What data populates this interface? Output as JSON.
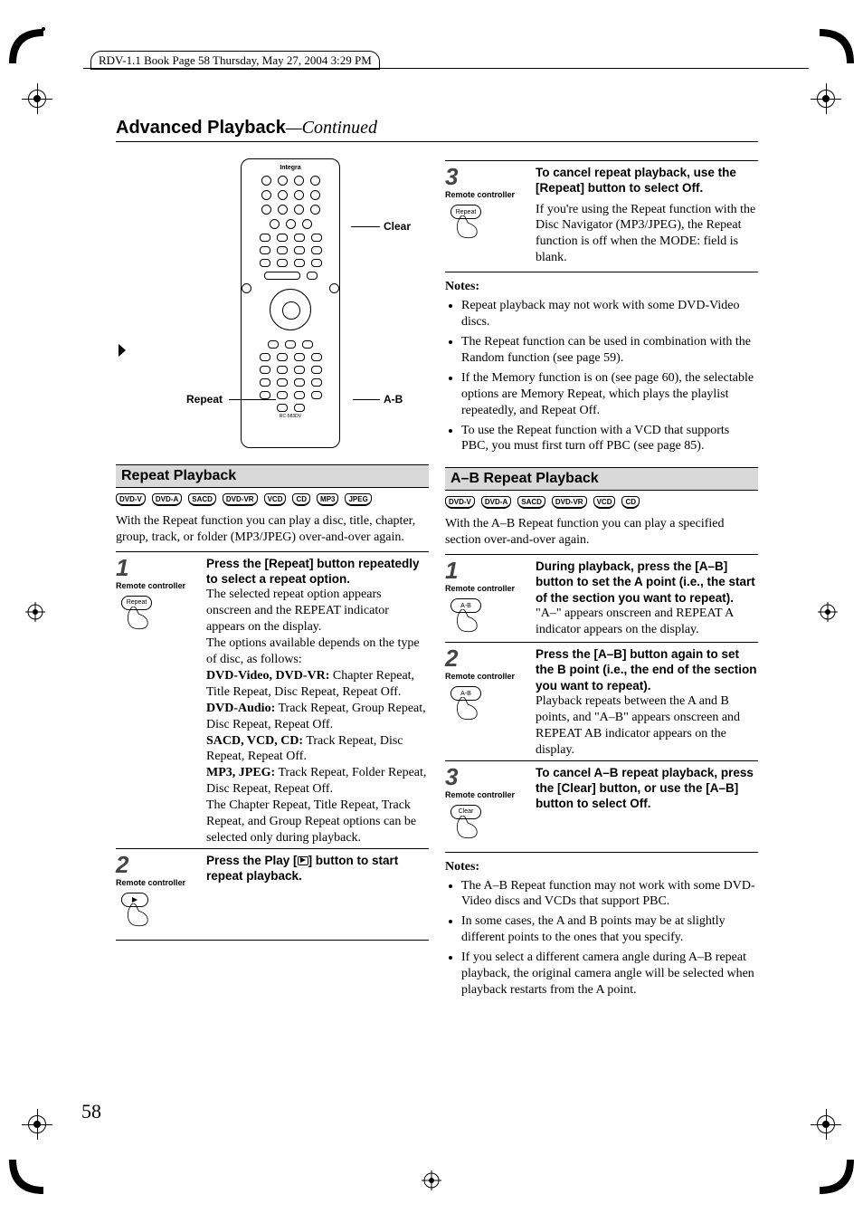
{
  "file_header": "RDV-1.1 Book Page 58 Thursday, May 27, 2004 3:29 PM",
  "title_main": "Advanced Playback",
  "title_cont": "—Continued",
  "remote_brand": "Integra",
  "remote_model": "RC-583DV",
  "callouts": {
    "clear": "Clear",
    "repeat": "Repeat",
    "ab": "A-B"
  },
  "left": {
    "section": "Repeat Playback",
    "formats": [
      "DVD-V",
      "DVD-A",
      "SACD",
      "DVD-VR",
      "VCD",
      "CD",
      "MP3",
      "JPEG"
    ],
    "intro": "With the Repeat function you can play a disc, title, chapter, group, track, or folder (MP3/JPEG) over-and-over again.",
    "step1": {
      "num": "1",
      "sub": "Remote controller",
      "btn": "Repeat",
      "lead": "Press the [Repeat] button repeatedly to select a repeat option.",
      "body_a": "The selected repeat option appears onscreen and the REPEAT indicator appears on the display.",
      "body_b": "The options available depends on the type of disc, as follows:",
      "o1_h": "DVD-Video, DVD-VR:",
      "o1_t": " Chapter Repeat, Title Repeat, Disc Repeat, Repeat Off.",
      "o2_h": "DVD-Audio:",
      "o2_t": " Track Repeat, Group Repeat, Disc Repeat, Repeat Off.",
      "o3_h": "SACD, VCD, CD:",
      "o3_t": " Track Repeat, Disc Repeat, Repeat Off.",
      "o4_h": "MP3, JPEG:",
      "o4_t": " Track Repeat, Folder Repeat, Disc Repeat, Repeat Off.",
      "tail": "The Chapter Repeat, Title Repeat, Track Repeat, and Group Repeat options can be selected only during playback."
    },
    "step2": {
      "num": "2",
      "sub": "Remote controller",
      "lead_a": "Press the Play [",
      "lead_b": "] button to start repeat playback."
    }
  },
  "right": {
    "step3": {
      "num": "3",
      "sub": "Remote controller",
      "btn": "Repeat",
      "lead": "To cancel repeat playback, use the [Repeat] button to select Off.",
      "body": "If you're using the Repeat function with the Disc Navigator (MP3/JPEG), the Repeat function is off when the MODE: field is blank."
    },
    "notes_h": "Notes:",
    "notes": [
      "Repeat playback may not work with some DVD-Video discs.",
      "The Repeat function can be used in combination with the Random function (see page 59).",
      "If the Memory function is on (see page 60), the selectable options are Memory Repeat, which plays the playlist repeatedly, and Repeat Off.",
      "To use the Repeat function with a VCD that supports PBC, you must first turn off PBC (see page 85)."
    ],
    "section": "A–B Repeat Playback",
    "formats": [
      "DVD-V",
      "DVD-A",
      "SACD",
      "DVD-VR",
      "VCD",
      "CD"
    ],
    "intro": "With the A–B Repeat function you can play a specified section over-and-over again.",
    "s1": {
      "num": "1",
      "sub": "Remote controller",
      "btn": "A-B",
      "lead": "During playback, press the [A–B] button to set the A point (i.e., the start of the section you want to repeat).",
      "body": "\"A–\" appears onscreen and REPEAT A indicator appears on the display."
    },
    "s2": {
      "num": "2",
      "sub": "Remote controller",
      "btn": "A-B",
      "lead": "Press the [A–B] button again to set the B point (i.e., the end of the section you want to repeat).",
      "body": "Playback repeats between the A and B points, and \"A–B\" appears onscreen and REPEAT AB indicator appears on the display."
    },
    "s3": {
      "num": "3",
      "sub": "Remote controller",
      "btn": "Clear",
      "lead": "To cancel A–B repeat playback, press the [Clear] button, or use the [A–B] button to select Off."
    },
    "notes2_h": "Notes:",
    "notes2": [
      "The A–B Repeat function may not work with some DVD-Video discs and VCDs that support PBC.",
      "In some cases, the A and B points may be at slightly different points to the ones that you specify.",
      "If you select a different camera angle during A–B repeat playback, the original camera angle will be selected when playback restarts from the A point."
    ]
  },
  "page_num": "58"
}
